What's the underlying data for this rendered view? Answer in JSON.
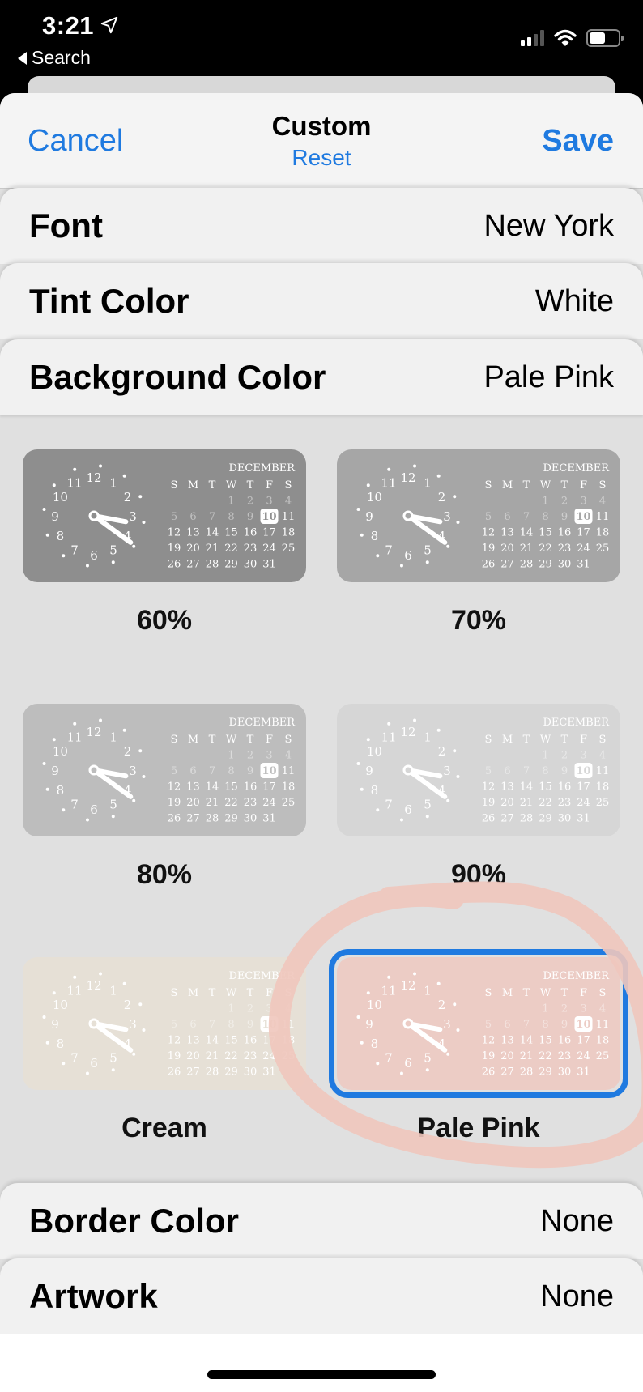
{
  "status_bar": {
    "time": "3:21",
    "back_label": "Search",
    "icons": [
      "location-arrow-icon",
      "signal-icon",
      "wifi-icon",
      "battery-icon"
    ]
  },
  "nav": {
    "cancel_label": "Cancel",
    "title": "Custom",
    "reset_label": "Reset",
    "save_label": "Save"
  },
  "settings_top": [
    {
      "label": "Font",
      "value": "New York"
    },
    {
      "label": "Tint Color",
      "value": "White"
    },
    {
      "label": "Background Color",
      "value": "Pale Pink"
    }
  ],
  "widget_preview": {
    "month": "DECEMBER",
    "weekdays": [
      "S",
      "M",
      "T",
      "W",
      "T",
      "F",
      "S"
    ],
    "first_weekday_index": 3,
    "days_in_month": 31,
    "today": 10,
    "clock_numerals": [
      "12",
      "1",
      "2",
      "3",
      "4",
      "5",
      "6",
      "7",
      "8",
      "9",
      "10",
      "11"
    ],
    "clock_time": "3:21"
  },
  "background_options": [
    {
      "label": "60%",
      "color": "#8e8e8e",
      "selected": false
    },
    {
      "label": "70%",
      "color": "#a6a6a6",
      "selected": false
    },
    {
      "label": "80%",
      "color": "#bdbdbd",
      "selected": false
    },
    {
      "label": "90%",
      "color": "#d6d6d6",
      "selected": false
    },
    {
      "label": "Cream",
      "color": "#e6e0d6",
      "selected": false
    },
    {
      "label": "Pale Pink",
      "color": "#ecccc5",
      "selected": true
    }
  ],
  "settings_bottom": [
    {
      "label": "Border Color",
      "value": "None"
    },
    {
      "label": "Artwork",
      "value": "None"
    }
  ],
  "colors": {
    "accent": "#1f7ae0",
    "annotation": "#f0c6bd"
  }
}
